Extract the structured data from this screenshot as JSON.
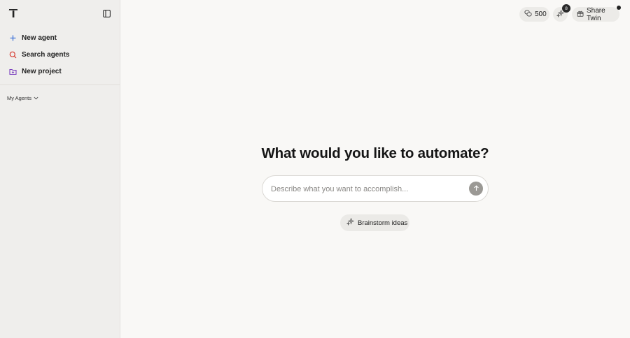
{
  "sidebar": {
    "items": [
      {
        "label": "New agent",
        "icon": "plus-icon"
      },
      {
        "label": "Search agents",
        "icon": "search-icon"
      },
      {
        "label": "New project",
        "icon": "folder-plus-icon"
      }
    ],
    "section_label": "My Agents"
  },
  "topbar": {
    "credits": "500",
    "notifications_count": "8",
    "share_label": "Share Twin"
  },
  "main": {
    "headline": "What would you like to automate?",
    "prompt_placeholder": "Describe what you want to accomplish...",
    "brainstorm_label": "Brainstorm ideas"
  },
  "colors": {
    "sidebar_bg": "#efeeec",
    "main_bg": "#f9f8f6",
    "accent_red": "#d63a2f",
    "accent_purple": "#7b3fbf",
    "accent_blue": "#3b6fd8"
  }
}
